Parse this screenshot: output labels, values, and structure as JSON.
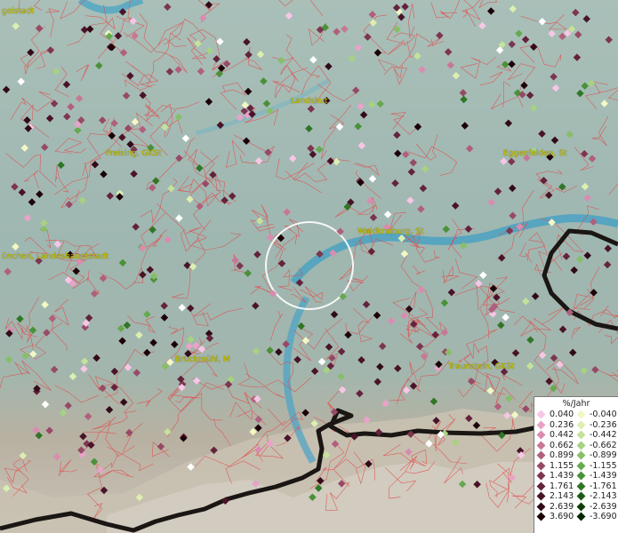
{
  "map": {
    "cities": [
      {
        "id": "ingolstadt",
        "label": "golstadt"
      },
      {
        "id": "landshut",
        "label": "Landshut"
      },
      {
        "id": "freising",
        "label": "Freising, GKSt"
      },
      {
        "id": "eggenfelden",
        "label": "Eggenfelden, St"
      },
      {
        "id": "waldkraiburg",
        "label": "Waldkraiburg, St"
      },
      {
        "id": "muenchen",
        "label": "ünchen, Landeshauptstadt"
      },
      {
        "id": "bruckmuehl",
        "label": "Bruckmühl, M"
      },
      {
        "id": "traunstein",
        "label": "Traunstein, GKSt"
      }
    ]
  },
  "legend": {
    "title": "%/Jahr",
    "positive": [
      {
        "label": "0.040",
        "color": "#f7c6e6"
      },
      {
        "label": "0.236",
        "color": "#e9a3c9"
      },
      {
        "label": "0.442",
        "color": "#d98cb0"
      },
      {
        "label": "0.662",
        "color": "#c77896"
      },
      {
        "label": "0.899",
        "color": "#b05f7c"
      },
      {
        "label": "1.155",
        "color": "#974a66"
      },
      {
        "label": "1.439",
        "color": "#7d3550"
      },
      {
        "label": "1.761",
        "color": "#64233c"
      },
      {
        "label": "2.143",
        "color": "#4a1428"
      },
      {
        "label": "2.639",
        "color": "#320a18"
      },
      {
        "label": "3.690",
        "color": "#1c0208"
      }
    ],
    "negative": [
      {
        "label": "-0.040",
        "color": "#f2f7c4"
      },
      {
        "label": "-0.236",
        "color": "#dcefb0"
      },
      {
        "label": "-0.442",
        "color": "#c3e29a"
      },
      {
        "label": "-0.662",
        "color": "#a6d282"
      },
      {
        "label": "-0.899",
        "color": "#87bf69"
      },
      {
        "label": "-1.155",
        "color": "#66a94f"
      },
      {
        "label": "-1.439",
        "color": "#4a9138"
      },
      {
        "label": "-1.761",
        "color": "#307626"
      },
      {
        "label": "-2.143",
        "color": "#1d5a17"
      },
      {
        "label": "-2.639",
        "color": "#0e3f0a"
      },
      {
        "label": "-3.690",
        "color": "#052703"
      }
    ]
  }
}
